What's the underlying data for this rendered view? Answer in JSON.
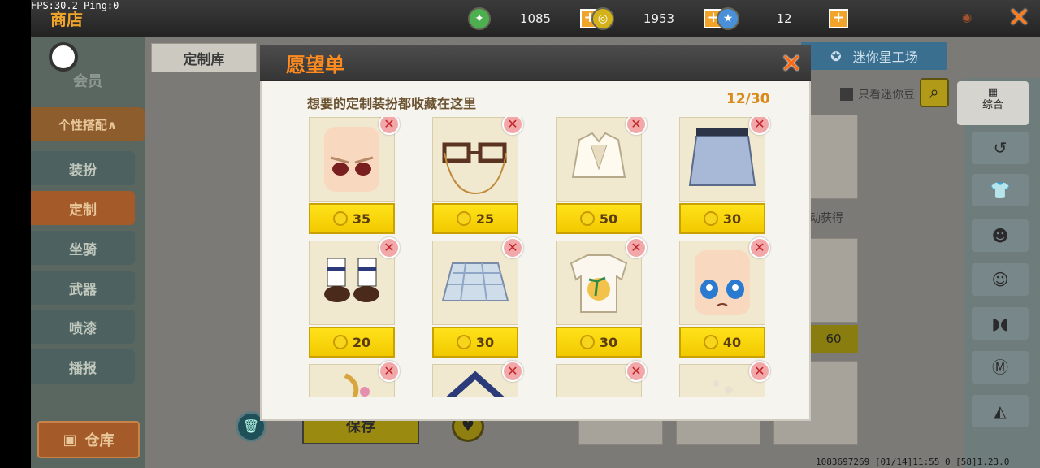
{
  "debug": {
    "fps_text": "FPS:30.2  Ping:0"
  },
  "header": {
    "title": "商店",
    "resources": [
      {
        "name": "mini-bean",
        "value": "1085",
        "color": "#4caf50"
      },
      {
        "name": "mini-coin",
        "value": "1953",
        "color": "#d4b21a"
      },
      {
        "name": "star-coin",
        "value": "12",
        "color": "#4a90d9"
      }
    ],
    "plus": "+",
    "close": "✕"
  },
  "sidebar": {
    "member": "会员",
    "items": [
      {
        "label": "个性搭配∧"
      },
      {
        "label": "装扮"
      },
      {
        "label": "定制"
      },
      {
        "label": "坐骑"
      },
      {
        "label": "武器"
      },
      {
        "label": "喷漆"
      },
      {
        "label": "播报"
      }
    ],
    "warehouse": "仓库"
  },
  "main": {
    "tab": "定制库",
    "workshop": "迷你星工场",
    "filter_label": "只看迷你豆",
    "category_selected": "综合",
    "partial_text": "动获得",
    "partial_price": "60",
    "save": "保存"
  },
  "modal": {
    "title": "愿望单",
    "subtitle": "想要的定制装扮都收藏在这里",
    "count": "12/30",
    "close": "✕",
    "items": [
      {
        "name": "face-red-eyes",
        "price": "35"
      },
      {
        "name": "glasses-chain",
        "price": "25"
      },
      {
        "name": "vest-shirt",
        "price": "50"
      },
      {
        "name": "blue-skirt",
        "price": "30"
      },
      {
        "name": "sock-shoes",
        "price": "20"
      },
      {
        "name": "plaid-skirt",
        "price": "30"
      },
      {
        "name": "palm-tshirt",
        "price": "30"
      },
      {
        "name": "face-blue-eyes",
        "price": "40"
      },
      {
        "name": "floral-hair",
        "price": ""
      },
      {
        "name": "sailor-collar",
        "price": ""
      },
      {
        "name": "dark-item",
        "price": ""
      },
      {
        "name": "white-item",
        "price": ""
      }
    ]
  },
  "footer": {
    "info": "1083697269   [01/14]11:55 0   [58]1.23.0"
  }
}
